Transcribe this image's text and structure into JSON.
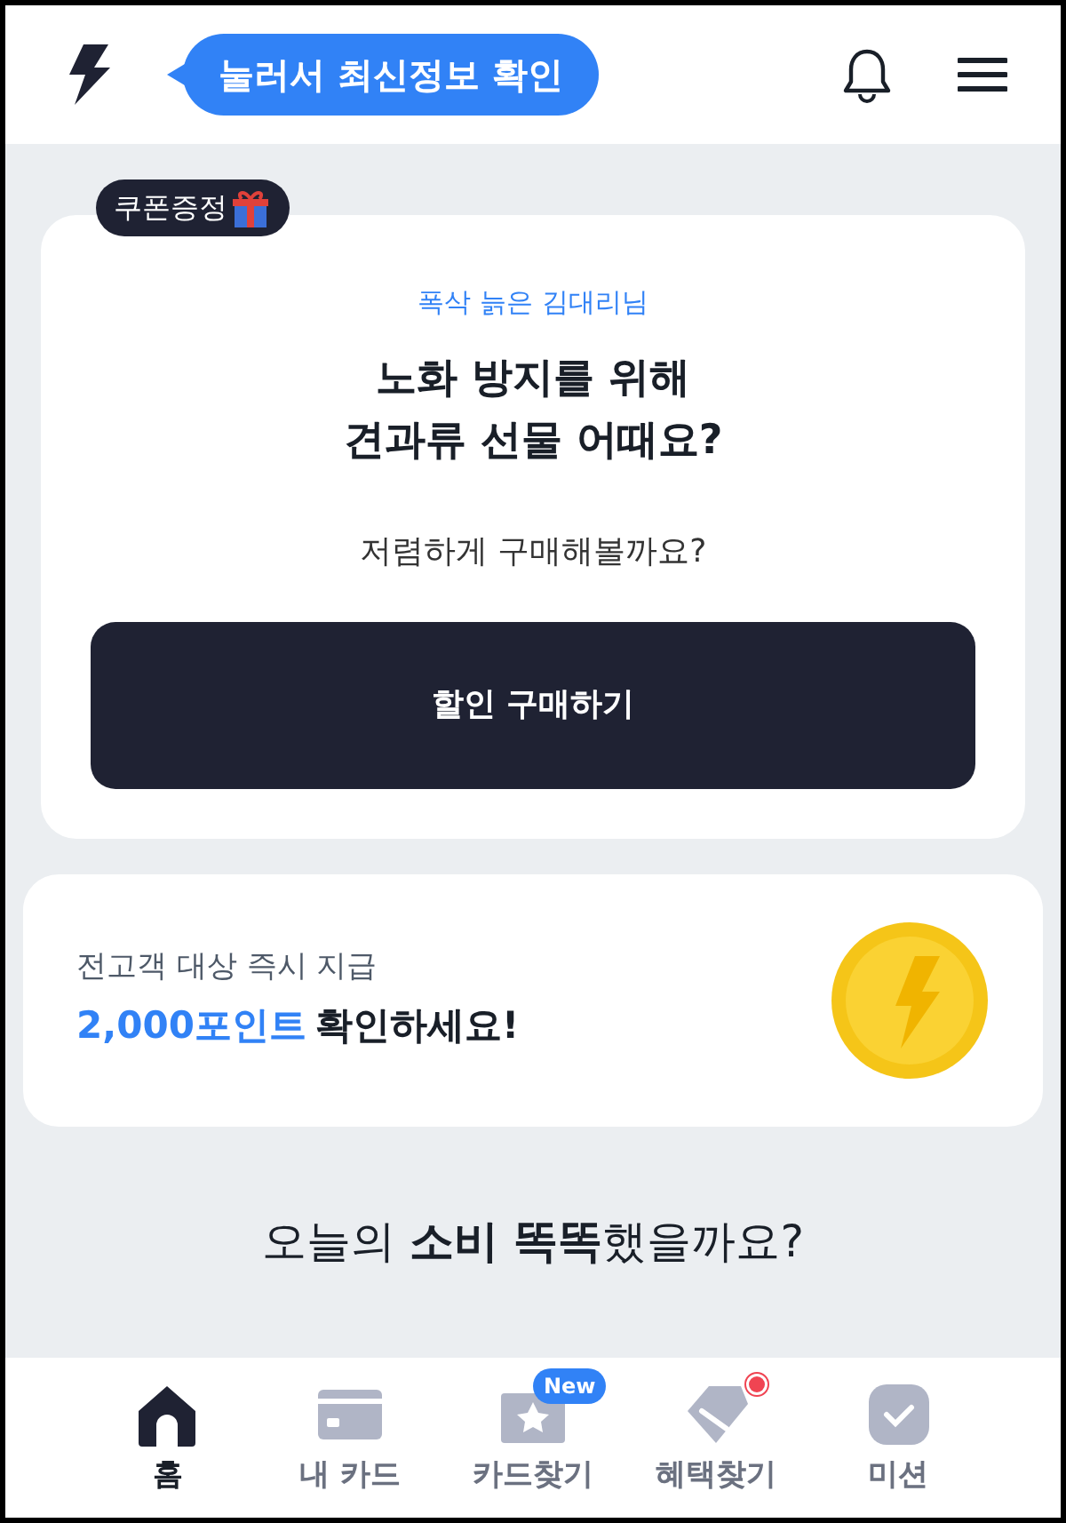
{
  "header": {
    "tooltip": "눌러서 최신정보 확인"
  },
  "coupon_card": {
    "badge": "쿠폰증정",
    "subtitle": "폭삭 늙은 김대리님",
    "title_lines": [
      "노화 방지를 위해",
      "견과류 선물 어때요?"
    ],
    "question": "저렴하게 구매해볼까요?",
    "button": "할인 구매하기"
  },
  "points_card": {
    "line1": "전고객 대상 즉시 지급",
    "highlight": "2,000포인트",
    "line2_rest": "확인하세요!"
  },
  "section_title": "오늘의 **소비 똑똑**했을까요?",
  "bottom_nav": [
    {
      "kind": "home",
      "label": "홈",
      "selected": true
    },
    {
      "kind": "card",
      "label": "내 카드",
      "selected": false
    },
    {
      "kind": "star",
      "label": "카드찾기",
      "selected": false,
      "badge": "New"
    },
    {
      "kind": "tag",
      "label": "혜택찾기",
      "selected": false,
      "dot": true
    },
    {
      "kind": "mission",
      "label": "미션",
      "selected": false
    }
  ]
}
